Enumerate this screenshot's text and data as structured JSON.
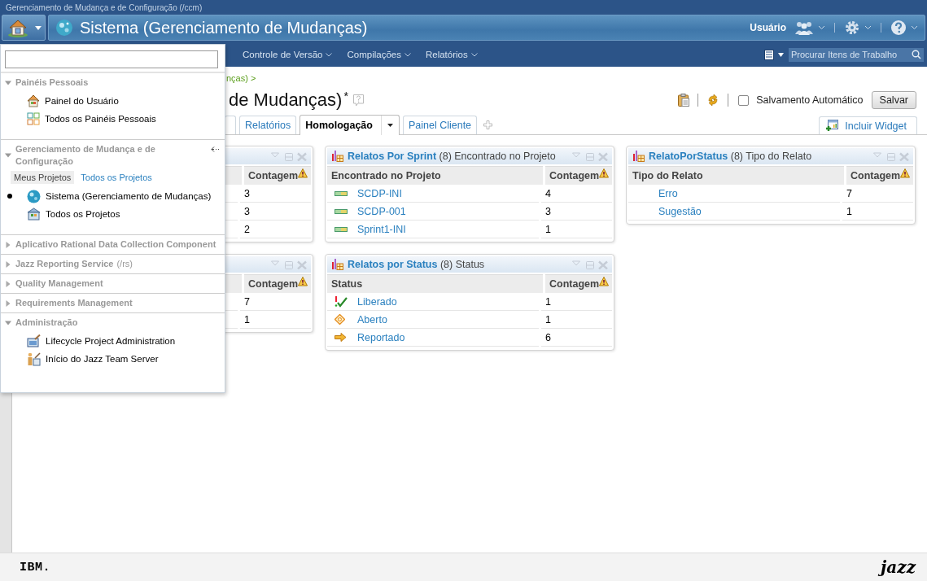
{
  "app_title": "Gerenciamento de Mudança e de Configuração (/ccm)",
  "project_title": "Sistema (Gerenciamento de Mudanças)",
  "user": {
    "label": "Usuário"
  },
  "nav": [
    {
      "label": "Controle de Versão"
    },
    {
      "label": "Compilações"
    },
    {
      "label": "Relatórios"
    }
  ],
  "search": {
    "placeholder": "Procurar Itens de Trabalho"
  },
  "breadcrumb": "nças) >",
  "page_title": "de Mudanças)",
  "modified_mark": "*",
  "autosave": {
    "label": "Salvamento Automático",
    "checked": false
  },
  "save_button": "Salvar",
  "tabs": [
    {
      "label": "Relatórios",
      "selected": false,
      "menu": false
    },
    {
      "label": "Homologação",
      "selected": true,
      "menu": true
    },
    {
      "label": "Painel Cliente",
      "selected": false,
      "menu": false
    }
  ],
  "add_widget": "Incluir Widget",
  "dashboard": {
    "columns": [
      [
        {
          "count_column": "Contagem",
          "rows": [
            {
              "value": "3"
            },
            {
              "value": "3"
            },
            {
              "value": "2"
            }
          ]
        },
        {
          "count_column": "Contagem",
          "rows": [
            {
              "value": "7"
            },
            {
              "value": "1"
            }
          ]
        }
      ],
      [
        {
          "title": "Relatos Por Sprint",
          "count": "(8)",
          "subtitle": "Encontrado no Projeto",
          "label_column": "Encontrado no Projeto",
          "count_column": "Contagem",
          "rows": [
            {
              "kind": "iteration",
              "label": "SCDP-INI",
              "value": "4"
            },
            {
              "kind": "iteration",
              "label": "SCDP-001",
              "value": "3"
            },
            {
              "kind": "iteration",
              "label": "Sprint1-INI",
              "value": "1"
            }
          ]
        },
        {
          "title": "Relatos por Status",
          "count": "(8)",
          "subtitle": "Status",
          "label_column": "Status",
          "count_column": "Contagem",
          "rows": [
            {
              "kind": "resolved",
              "label": "Liberado",
              "value": "1"
            },
            {
              "kind": "new",
              "label": "Aberto",
              "value": "1"
            },
            {
              "kind": "reported",
              "label": "Reportado",
              "value": "6"
            }
          ]
        }
      ],
      [
        {
          "title": "RelatoPorStatus",
          "count": "(8)",
          "subtitle": "Tipo do Relato",
          "label_column": "Tipo do Relato",
          "count_column": "Contagem",
          "rows": [
            {
              "label": "Erro",
              "value": "7"
            },
            {
              "label": "Sugestão",
              "value": "1"
            }
          ]
        }
      ]
    ]
  },
  "menu": {
    "sections": [
      {
        "title": "Painéis Pessoais",
        "expanded": true,
        "items": [
          {
            "kind": "home",
            "label": "Painel do Usuário",
            "current": false
          },
          {
            "kind": "dashboards",
            "label": "Todos os Painéis Pessoais",
            "current": false
          }
        ]
      },
      {
        "title": "Gerenciamento de Mudança e de Configuração",
        "expanded": true,
        "pin": true,
        "filters": [
          {
            "label": "Meus Projetos",
            "selected": true
          },
          {
            "label": "Todos os Projetos",
            "selected": false
          }
        ],
        "items": [
          {
            "kind": "globe",
            "label": "Sistema (Gerenciamento de Mudanças)",
            "current": true
          },
          {
            "kind": "projects",
            "label": "Todos os Projetos",
            "current": false
          }
        ]
      },
      {
        "title": "Aplicativo Rational Data Collection Component",
        "expanded": false
      },
      {
        "title": "Jazz Reporting Service",
        "suffix": "(/rs)",
        "expanded": false
      },
      {
        "title": "Quality Management",
        "expanded": false
      },
      {
        "title": "Requirements Management",
        "expanded": false
      },
      {
        "title": "Administração",
        "expanded": true,
        "items": [
          {
            "kind": "admin",
            "label": "Lifecycle Project Administration",
            "current": false
          },
          {
            "kind": "server",
            "label": "Início do Jazz Team Server",
            "current": false
          }
        ]
      }
    ]
  },
  "footer": {
    "ibm": "IBM.",
    "jazz": "jazz"
  }
}
